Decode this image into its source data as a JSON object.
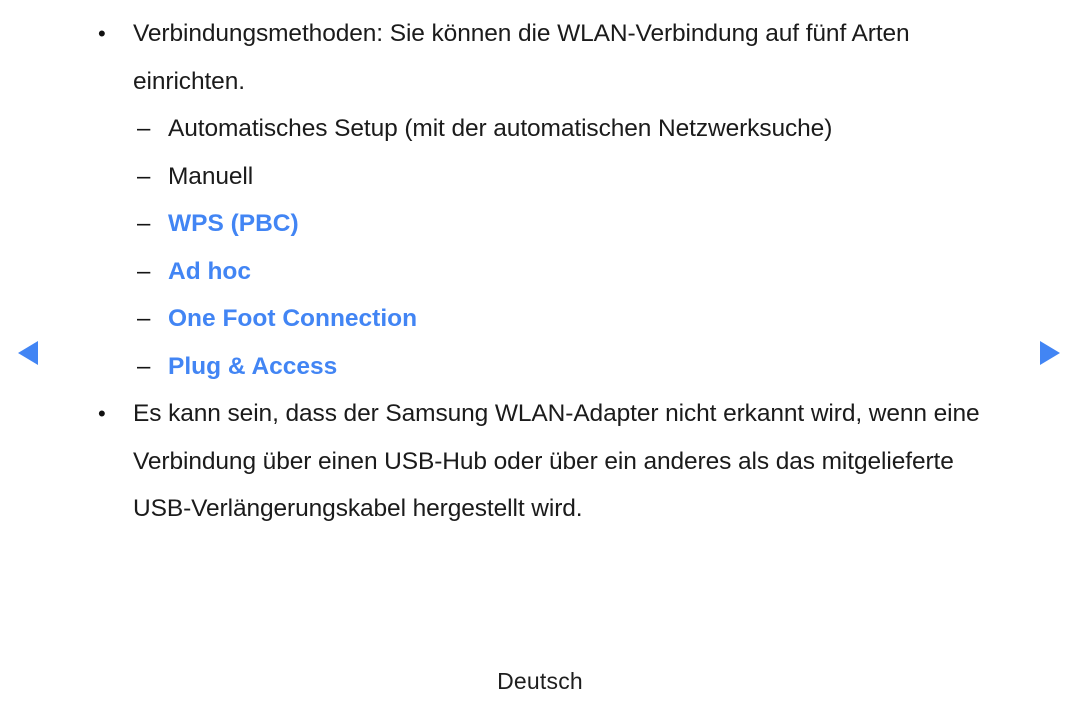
{
  "page": {
    "language_footer": "Deutsch",
    "accent_color": "#4285f4",
    "text_color": "#1b1b1b",
    "background_color": "#ffffff"
  },
  "nav": {
    "prev_label": "prev-page-arrow",
    "next_label": "next-page-arrow"
  },
  "bullets": {
    "first": {
      "marker": "•",
      "text": "Verbindungsmethoden: Sie können die WLAN-Verbindung auf fünf Arten\neinrichten."
    },
    "second": {
      "marker": "•",
      "text": "Es kann sein, dass der Samsung WLAN-Adapter nicht erkannt wird, wenn eine\nVerbindung über einen USB-Hub oder über ein anderes als das mitgelieferte\nUSB-Verlängerungskabel hergestellt wird."
    }
  },
  "sub_items": [
    {
      "dash": "–",
      "label": "Automatisches Setup (mit der automatischen Netzwerksuche)",
      "link": false
    },
    {
      "dash": "–",
      "label": "Manuell",
      "link": false
    },
    {
      "dash": "–",
      "label": "WPS (PBC)",
      "link": true
    },
    {
      "dash": "–",
      "label": "Ad hoc",
      "link": true
    },
    {
      "dash": "–",
      "label": "One Foot Connection",
      "link": true
    },
    {
      "dash": "–",
      "label": "Plug & Access",
      "link": true
    }
  ]
}
